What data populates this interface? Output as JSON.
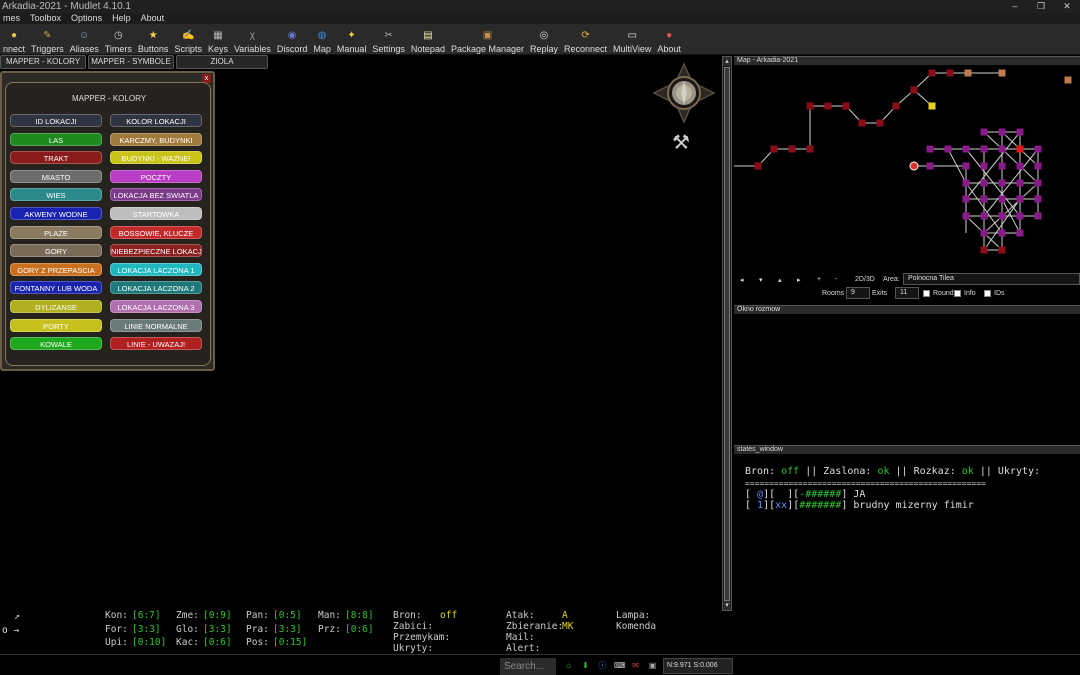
{
  "app": {
    "title": "Arkadia-2021 - Mudlet 4.10.1",
    "controls": [
      "–",
      "❐",
      "✕"
    ]
  },
  "menu": [
    "mes",
    "Toolbox",
    "Options",
    "Help",
    "About"
  ],
  "toolbar": [
    {
      "label": "nnect",
      "icon": "connect-icon",
      "color": "#e8c14a"
    },
    {
      "label": "Triggers",
      "icon": "triggers-icon",
      "color": "#c9a24a"
    },
    {
      "label": "Aliases",
      "icon": "aliases-icon",
      "color": "#8fa0c8"
    },
    {
      "label": "Timers",
      "icon": "timers-icon",
      "color": "#d0d0d0"
    },
    {
      "label": "Buttons",
      "icon": "buttons-icon",
      "color": "#f2d24a"
    },
    {
      "label": "Scripts",
      "icon": "scripts-icon",
      "color": "#bfbfbf"
    },
    {
      "label": "Keys",
      "icon": "keys-icon",
      "color": "#bcbcbc"
    },
    {
      "label": "Variables",
      "icon": "variables-icon",
      "color": "#9a9a9a"
    },
    {
      "label": "Discord",
      "icon": "discord-icon",
      "color": "#6c78d8"
    },
    {
      "label": "Map",
      "icon": "map-icon",
      "color": "#3a8fe0"
    },
    {
      "label": "Manual",
      "icon": "manual-icon",
      "color": "#f0d040"
    },
    {
      "label": "Settings",
      "icon": "settings-icon",
      "color": "#b0b0b0"
    },
    {
      "label": "Notepad",
      "icon": "notepad-icon",
      "color": "#f3e9a8"
    },
    {
      "label": "Package Manager",
      "icon": "package-icon",
      "color": "#c89050"
    },
    {
      "label": "Replay",
      "icon": "replay-icon",
      "color": "#dedede"
    },
    {
      "label": "Reconnect",
      "icon": "reconnect-icon",
      "color": "#f0b040"
    },
    {
      "label": "MultiView",
      "icon": "multiview-icon",
      "color": "#e8e8e8"
    },
    {
      "label": "About",
      "icon": "about-icon",
      "color": "#e05050"
    }
  ],
  "tabs": [
    "MAPPER - KOLORY",
    "MAPPER - SYMBOLE",
    "ZIOLA"
  ],
  "mapper": {
    "title": "MAPPER - KOLORY",
    "close": "x",
    "buttons": [
      [
        "ID LOKACJI",
        "KOLOR LOKACJI"
      ],
      [
        "LAS",
        "KARCZMY, BUDYNKI"
      ],
      [
        "TRAKT",
        "BUDYNKI - WAZNE!"
      ],
      [
        "MIASTO",
        "POCZTY"
      ],
      [
        "WIES",
        "LOKACJA BEZ SWIATLA"
      ],
      [
        "AKWENY WODNE",
        "STARTOWKA"
      ],
      [
        "PLAZE",
        "BOSSOWIE, KLUCZE"
      ],
      [
        "GORY",
        "NIEBEZPIECZNE LOKACJE"
      ],
      [
        "GORY Z PRZEPASCIA",
        "LOKACJA LACZONA 1"
      ],
      [
        "FONTANNY LUB WODA",
        "LOKACJA LACZONA 2"
      ],
      [
        "DYLIZANSE",
        "LOKACJA LACZONA 3"
      ],
      [
        "PORTY",
        "LINIE NORMALNE"
      ],
      [
        "KOWALE",
        "LINIE - UWAZAJ!"
      ]
    ],
    "colors": [
      [
        "#2e3440",
        "#2e3440"
      ],
      [
        "#1e8a1e",
        "#a07a3a"
      ],
      [
        "#8a1c1c",
        "#c9c417"
      ],
      [
        "#6c6c6c",
        "#b83cc4"
      ],
      [
        "#2e8a8a",
        "#7c3a8a"
      ],
      [
        "#1a22b0",
        "#bdbdbd"
      ],
      [
        "#8a7a60",
        "#c02a2a"
      ],
      [
        "#7a6a58",
        "#8a2020"
      ],
      [
        "#c8701e",
        "#20b8c0"
      ],
      [
        "#1a22b0",
        "#1e7a7a"
      ],
      [
        "#b0b01e",
        "#b070b0"
      ],
      [
        "#c8c01e",
        "#6a7a7a"
      ],
      [
        "#1ea81e",
        "#b02020"
      ]
    ]
  },
  "map": {
    "title": "Map - Arkadia-2021",
    "controls": [
      "◂",
      "▾",
      "▴",
      "▸",
      "+",
      "-"
    ],
    "mode": "2D/3D",
    "area_label": "Area:",
    "area": "Polnocna Tilea",
    "rooms_label": "Rooms",
    "rooms": "9",
    "exits_label": "Exits",
    "exits": "11",
    "round": "Round",
    "info": "Info",
    "ids": "IDs"
  },
  "okno": {
    "title": "Okno rozmow"
  },
  "states": {
    "title": "states_window",
    "l1": [
      [
        "Bron: ",
        "w"
      ],
      [
        "off",
        "g"
      ],
      [
        " || Zaslona: ",
        "w"
      ],
      [
        "ok",
        "g"
      ],
      [
        " || Rozkaz: ",
        "w"
      ],
      [
        "ok",
        "g"
      ],
      [
        " || Ukryty:",
        "w"
      ]
    ],
    "l2": "==================================================",
    "l3": [
      [
        "[ ",
        "w"
      ],
      [
        "@",
        "b"
      ],
      [
        "][  ][",
        "w"
      ],
      [
        "-######",
        "g"
      ],
      [
        "] JA",
        "w"
      ]
    ],
    "l4": [
      [
        "[ ",
        "w"
      ],
      [
        "1",
        "b"
      ],
      [
        "][",
        "w"
      ],
      [
        "xx",
        "b"
      ],
      [
        "][",
        "w"
      ],
      [
        "#######",
        "g"
      ],
      [
        "] brudny mizerny fimir",
        "w"
      ]
    ]
  },
  "status": {
    "left": [
      "↗",
      "o →"
    ],
    "stats": [
      [
        "Kon:",
        "[6:7]",
        "Zme:",
        "[0:9]",
        "Pan:",
        "[0:5]",
        "Man:",
        "[8:8]"
      ],
      [
        "For:",
        "[3:3]",
        "Glo:",
        "[3:3]",
        "Pra:",
        "[3:3]",
        "Prz:",
        "[0:6]"
      ],
      [
        "Upi:",
        "[0:10]",
        "Kac:",
        "[0:6]",
        "Pos:",
        "[0:15]"
      ]
    ],
    "bron_label": "Bron:",
    "bron_value": "off",
    "zabici": "Zabici:",
    "przemykam": "Przemykam:",
    "ukryty": "Ukryty:",
    "atak_label": "Atak:",
    "atak_value": "A",
    "zbieranie_label": "Zbieranie:",
    "zbieranie_value": "MK",
    "mail": "Mail:",
    "alert": "Alert:",
    "lampa": "Lampa:",
    "komenda": "Komenda"
  },
  "bottom": {
    "search_placeholder": "Search...",
    "net": "N:9.971 S:0.006"
  }
}
